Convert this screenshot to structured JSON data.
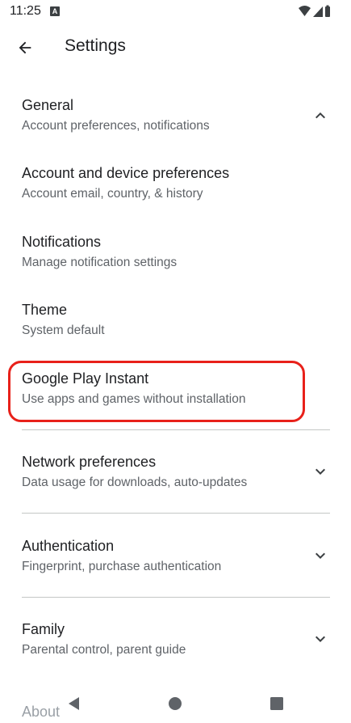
{
  "status_bar": {
    "time": "11:25",
    "notification_badge": "A"
  },
  "header": {
    "title": "Settings",
    "back_icon": "arrow-back-icon"
  },
  "settings": [
    {
      "title": "General",
      "subtitle": "Account preferences, notifications",
      "expand_icon": "chevron-up-icon"
    },
    {
      "title": "Account and device preferences",
      "subtitle": "Account email, country, & history"
    },
    {
      "title": "Notifications",
      "subtitle": "Manage notification settings"
    },
    {
      "title": "Theme",
      "subtitle": "System default"
    },
    {
      "title": "Google Play Instant",
      "subtitle": "Use apps and games without installation",
      "highlighted": true
    },
    {
      "title": "Network preferences",
      "subtitle": "Data usage for downloads, auto-updates",
      "expand_icon": "chevron-down-icon"
    },
    {
      "title": "Authentication",
      "subtitle": "Fingerprint, purchase authentication",
      "expand_icon": "chevron-down-icon"
    },
    {
      "title": "Family",
      "subtitle": "Parental control, parent guide",
      "expand_icon": "chevron-down-icon"
    },
    {
      "title": "About"
    }
  ],
  "colors": {
    "highlight": "#e8211a",
    "text_primary": "#202124",
    "text_secondary": "#5f6368"
  }
}
